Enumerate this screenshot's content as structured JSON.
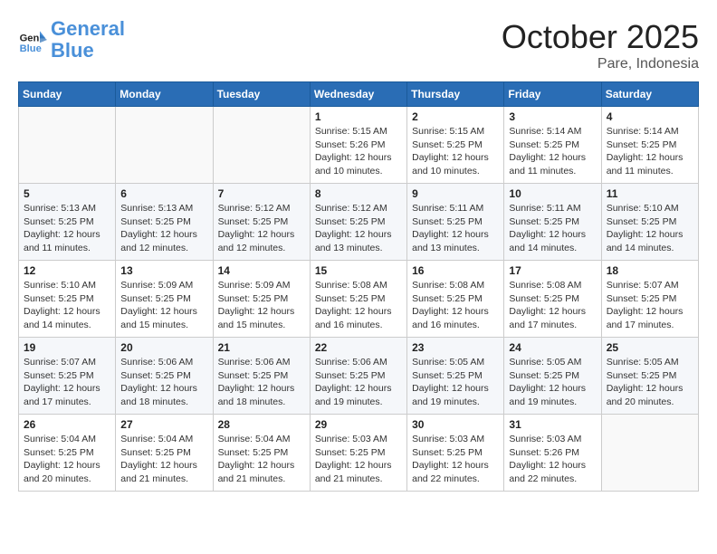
{
  "header": {
    "logo_line1": "General",
    "logo_line2": "Blue",
    "month": "October 2025",
    "location": "Pare, Indonesia"
  },
  "weekdays": [
    "Sunday",
    "Monday",
    "Tuesday",
    "Wednesday",
    "Thursday",
    "Friday",
    "Saturday"
  ],
  "weeks": [
    [
      {
        "day": "",
        "info": ""
      },
      {
        "day": "",
        "info": ""
      },
      {
        "day": "",
        "info": ""
      },
      {
        "day": "1",
        "info": "Sunrise: 5:15 AM\nSunset: 5:26 PM\nDaylight: 12 hours\nand 10 minutes."
      },
      {
        "day": "2",
        "info": "Sunrise: 5:15 AM\nSunset: 5:25 PM\nDaylight: 12 hours\nand 10 minutes."
      },
      {
        "day": "3",
        "info": "Sunrise: 5:14 AM\nSunset: 5:25 PM\nDaylight: 12 hours\nand 11 minutes."
      },
      {
        "day": "4",
        "info": "Sunrise: 5:14 AM\nSunset: 5:25 PM\nDaylight: 12 hours\nand 11 minutes."
      }
    ],
    [
      {
        "day": "5",
        "info": "Sunrise: 5:13 AM\nSunset: 5:25 PM\nDaylight: 12 hours\nand 11 minutes."
      },
      {
        "day": "6",
        "info": "Sunrise: 5:13 AM\nSunset: 5:25 PM\nDaylight: 12 hours\nand 12 minutes."
      },
      {
        "day": "7",
        "info": "Sunrise: 5:12 AM\nSunset: 5:25 PM\nDaylight: 12 hours\nand 12 minutes."
      },
      {
        "day": "8",
        "info": "Sunrise: 5:12 AM\nSunset: 5:25 PM\nDaylight: 12 hours\nand 13 minutes."
      },
      {
        "day": "9",
        "info": "Sunrise: 5:11 AM\nSunset: 5:25 PM\nDaylight: 12 hours\nand 13 minutes."
      },
      {
        "day": "10",
        "info": "Sunrise: 5:11 AM\nSunset: 5:25 PM\nDaylight: 12 hours\nand 14 minutes."
      },
      {
        "day": "11",
        "info": "Sunrise: 5:10 AM\nSunset: 5:25 PM\nDaylight: 12 hours\nand 14 minutes."
      }
    ],
    [
      {
        "day": "12",
        "info": "Sunrise: 5:10 AM\nSunset: 5:25 PM\nDaylight: 12 hours\nand 14 minutes."
      },
      {
        "day": "13",
        "info": "Sunrise: 5:09 AM\nSunset: 5:25 PM\nDaylight: 12 hours\nand 15 minutes."
      },
      {
        "day": "14",
        "info": "Sunrise: 5:09 AM\nSunset: 5:25 PM\nDaylight: 12 hours\nand 15 minutes."
      },
      {
        "day": "15",
        "info": "Sunrise: 5:08 AM\nSunset: 5:25 PM\nDaylight: 12 hours\nand 16 minutes."
      },
      {
        "day": "16",
        "info": "Sunrise: 5:08 AM\nSunset: 5:25 PM\nDaylight: 12 hours\nand 16 minutes."
      },
      {
        "day": "17",
        "info": "Sunrise: 5:08 AM\nSunset: 5:25 PM\nDaylight: 12 hours\nand 17 minutes."
      },
      {
        "day": "18",
        "info": "Sunrise: 5:07 AM\nSunset: 5:25 PM\nDaylight: 12 hours\nand 17 minutes."
      }
    ],
    [
      {
        "day": "19",
        "info": "Sunrise: 5:07 AM\nSunset: 5:25 PM\nDaylight: 12 hours\nand 17 minutes."
      },
      {
        "day": "20",
        "info": "Sunrise: 5:06 AM\nSunset: 5:25 PM\nDaylight: 12 hours\nand 18 minutes."
      },
      {
        "day": "21",
        "info": "Sunrise: 5:06 AM\nSunset: 5:25 PM\nDaylight: 12 hours\nand 18 minutes."
      },
      {
        "day": "22",
        "info": "Sunrise: 5:06 AM\nSunset: 5:25 PM\nDaylight: 12 hours\nand 19 minutes."
      },
      {
        "day": "23",
        "info": "Sunrise: 5:05 AM\nSunset: 5:25 PM\nDaylight: 12 hours\nand 19 minutes."
      },
      {
        "day": "24",
        "info": "Sunrise: 5:05 AM\nSunset: 5:25 PM\nDaylight: 12 hours\nand 19 minutes."
      },
      {
        "day": "25",
        "info": "Sunrise: 5:05 AM\nSunset: 5:25 PM\nDaylight: 12 hours\nand 20 minutes."
      }
    ],
    [
      {
        "day": "26",
        "info": "Sunrise: 5:04 AM\nSunset: 5:25 PM\nDaylight: 12 hours\nand 20 minutes."
      },
      {
        "day": "27",
        "info": "Sunrise: 5:04 AM\nSunset: 5:25 PM\nDaylight: 12 hours\nand 21 minutes."
      },
      {
        "day": "28",
        "info": "Sunrise: 5:04 AM\nSunset: 5:25 PM\nDaylight: 12 hours\nand 21 minutes."
      },
      {
        "day": "29",
        "info": "Sunrise: 5:03 AM\nSunset: 5:25 PM\nDaylight: 12 hours\nand 21 minutes."
      },
      {
        "day": "30",
        "info": "Sunrise: 5:03 AM\nSunset: 5:25 PM\nDaylight: 12 hours\nand 22 minutes."
      },
      {
        "day": "31",
        "info": "Sunrise: 5:03 AM\nSunset: 5:26 PM\nDaylight: 12 hours\nand 22 minutes."
      },
      {
        "day": "",
        "info": ""
      }
    ]
  ]
}
